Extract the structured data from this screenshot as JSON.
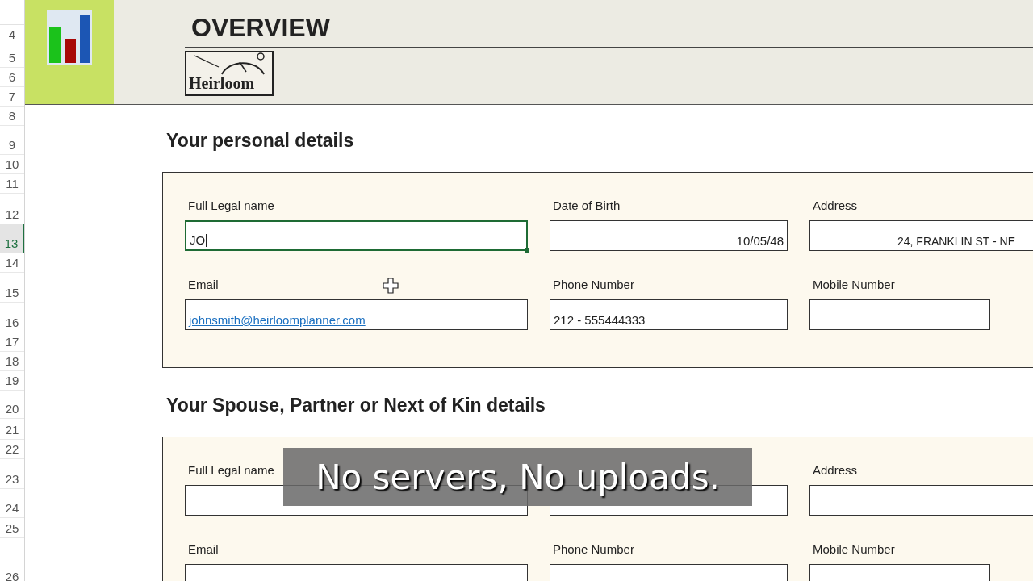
{
  "row_numbers": [
    {
      "label": "4",
      "selected": false
    },
    {
      "label": "5",
      "selected": false
    },
    {
      "label": "6",
      "selected": false
    },
    {
      "label": "7",
      "selected": false
    },
    {
      "label": "8",
      "selected": false
    },
    {
      "label": "9",
      "selected": false
    },
    {
      "label": "10",
      "selected": false
    },
    {
      "label": "11",
      "selected": false
    },
    {
      "label": "12",
      "selected": false
    },
    {
      "label": "13",
      "selected": true
    },
    {
      "label": "14",
      "selected": false
    },
    {
      "label": "15",
      "selected": false
    },
    {
      "label": "16",
      "selected": false
    },
    {
      "label": "17",
      "selected": false
    },
    {
      "label": "18",
      "selected": false
    },
    {
      "label": "19",
      "selected": false
    },
    {
      "label": "20",
      "selected": false
    },
    {
      "label": "21",
      "selected": false
    },
    {
      "label": "22",
      "selected": false
    },
    {
      "label": "23",
      "selected": false
    },
    {
      "label": "24",
      "selected": false
    },
    {
      "label": "25",
      "selected": false
    },
    {
      "label": "26",
      "selected": false
    }
  ],
  "header": {
    "title": "OVERVIEW",
    "logo_text": "Heirloom"
  },
  "sections": [
    {
      "title": "Your personal details",
      "fields": [
        {
          "label": "Full Legal name",
          "value": "JO",
          "kind": "text",
          "selected": true
        },
        {
          "label": "Date of Birth",
          "value": "10/05/48",
          "kind": "date",
          "selected": false
        },
        {
          "label": "Address",
          "value": "24, FRANKLIN ST - NE",
          "kind": "address",
          "selected": false
        },
        {
          "label": "Email",
          "value": "johnsmith@heirloomplanner.com",
          "kind": "link",
          "selected": false
        },
        {
          "label": "Phone Number",
          "value": "212 - 555444333",
          "kind": "text",
          "selected": false
        },
        {
          "label": "Mobile Number",
          "kind": "short",
          "selected": false
        }
      ]
    },
    {
      "title": "Your Spouse, Partner or Next of Kin details",
      "fields": [
        {
          "label": "Full Legal name",
          "kind": "text",
          "selected": false
        },
        {
          "kind": "date",
          "selected": false
        },
        {
          "label": "Address",
          "kind": "address",
          "selected": false
        },
        {
          "label": "Email",
          "kind": "text",
          "selected": false
        },
        {
          "label": "Phone Number",
          "kind": "text",
          "selected": false
        },
        {
          "label": "Mobile Number",
          "kind": "short",
          "selected": false
        }
      ]
    }
  ],
  "caption": "No servers, No uploads."
}
